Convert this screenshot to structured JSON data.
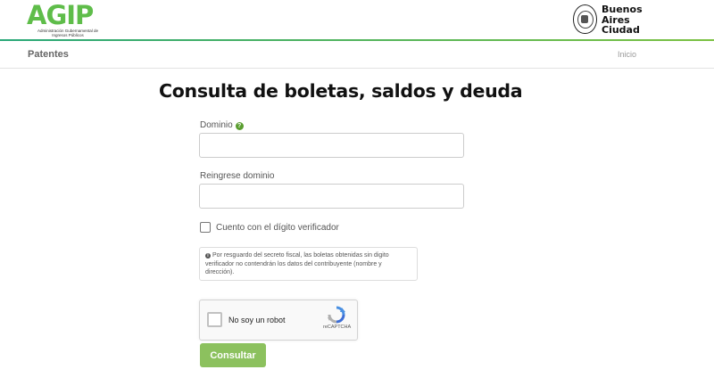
{
  "header": {
    "agip_logo": {
      "main": "AGIP",
      "subtitle": "Administración Gubernamental de Ingresos Públicos"
    },
    "ba_logo": {
      "line1": "Buenos",
      "line2": "Aires",
      "line3": "Ciudad"
    },
    "accent_colors": {
      "agip_teal": "#2fa87a",
      "agip_green": "#5fbd4a",
      "bar_green": "#7cc142"
    }
  },
  "nav": {
    "title": "Patentes",
    "home_link": "Inicio"
  },
  "page": {
    "title": "Consulta de boletas, saldos y deuda"
  },
  "form": {
    "dominio": {
      "label": "Dominio",
      "value": "",
      "help_icon": "question-circle-icon"
    },
    "reingrese": {
      "label": "Reingrese dominio",
      "value": ""
    },
    "checkbox": {
      "label": "Cuento con el dígito verificador",
      "checked": false
    },
    "info": {
      "icon": "info-circle-icon",
      "text": "Por resguardo del secreto fiscal, las boletas obtenidas sin digito verificador no contendrán los datos del contribuyente (nombre y dirección)."
    },
    "recaptcha": {
      "label": "No soy un robot",
      "brand": "reCAPTCHA",
      "checked": false
    },
    "submit_label": "Consultar",
    "submit_color": "#8cc15e"
  }
}
